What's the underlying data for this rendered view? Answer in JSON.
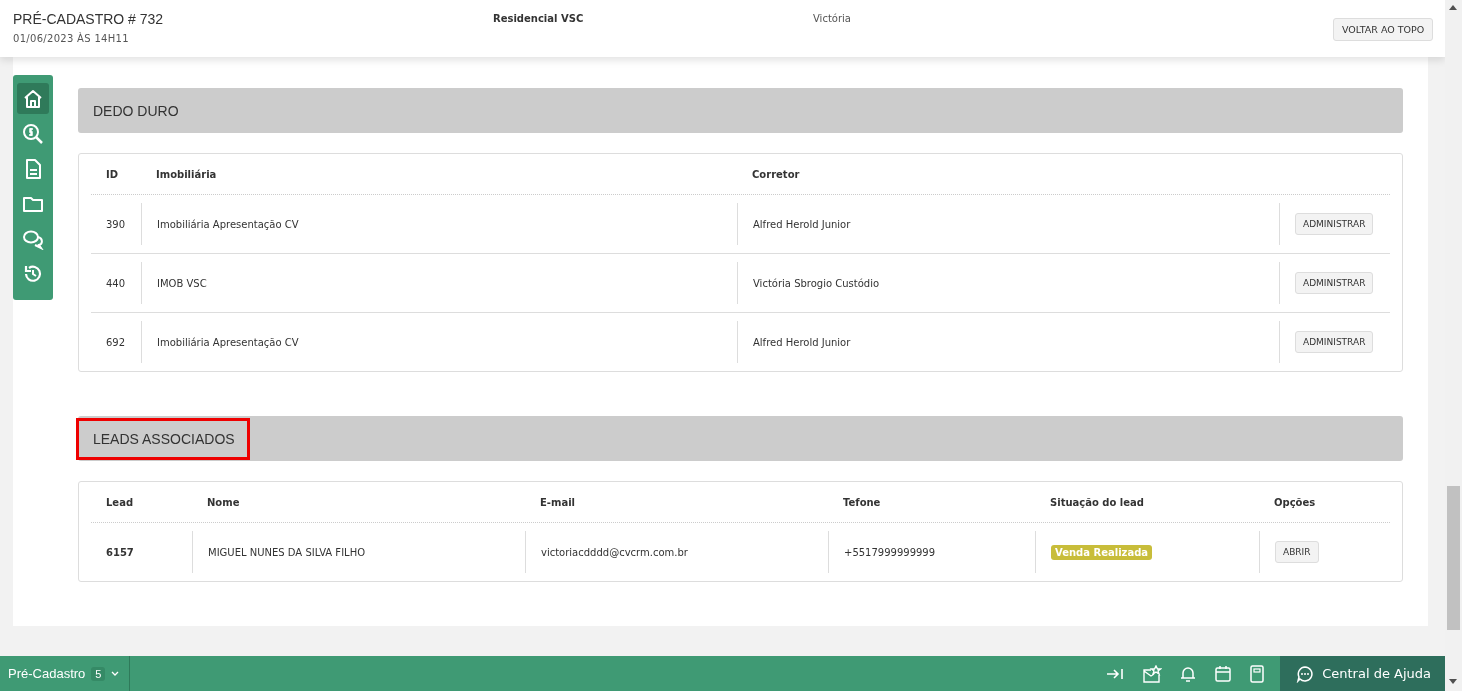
{
  "header": {
    "title": "PRÉ-CADASTRO # 732",
    "date": "01/06/2023 ÀS 14H11",
    "project": "Residencial VSC",
    "user": "Victória",
    "button": "VOLTAR AO TOPO"
  },
  "sidebar": {
    "items": [
      {
        "selected": true
      },
      {
        "selected": false
      },
      {
        "selected": false
      },
      {
        "selected": false
      },
      {
        "selected": false
      },
      {
        "selected": false
      }
    ]
  },
  "dedo_duro": {
    "title": "DEDO DURO",
    "highlighted": false,
    "columns": [
      "ID",
      "Imobiliária",
      "Corretor"
    ],
    "rows": [
      {
        "id": "390",
        "imobiliaria": "Imobiliária Apresentação CV",
        "corretor": "Alfred Herold Junior",
        "action": "ADMINISTRAR"
      },
      {
        "id": "440",
        "imobiliaria": "IMOB VSC",
        "corretor": "Victória Sbrogio Custódio",
        "action": "ADMINISTRAR"
      },
      {
        "id": "692",
        "imobiliaria": "Imobiliária Apresentação CV",
        "corretor": "Alfred Herold Junior",
        "action": "ADMINISTRAR"
      }
    ]
  },
  "leads": {
    "title": "LEADS ASSOCIADOS",
    "highlighted": true,
    "columns": [
      "Lead",
      "Nome",
      "E-mail",
      "Tefone",
      "Situação do lead",
      "Opções"
    ],
    "rows": [
      {
        "lead": "6157",
        "nome": "MIGUEL NUNES DA SILVA FILHO",
        "email": "victoriacdddd@cvcrm.com.br",
        "telefone": "+5517999999999",
        "situacao": "Venda Realizada",
        "color": "#c8bd3a",
        "action": "ABRIR"
      }
    ]
  },
  "footer": {
    "module": "Pré-Cadastro",
    "count": "5",
    "help": "Central de Ajuda"
  }
}
